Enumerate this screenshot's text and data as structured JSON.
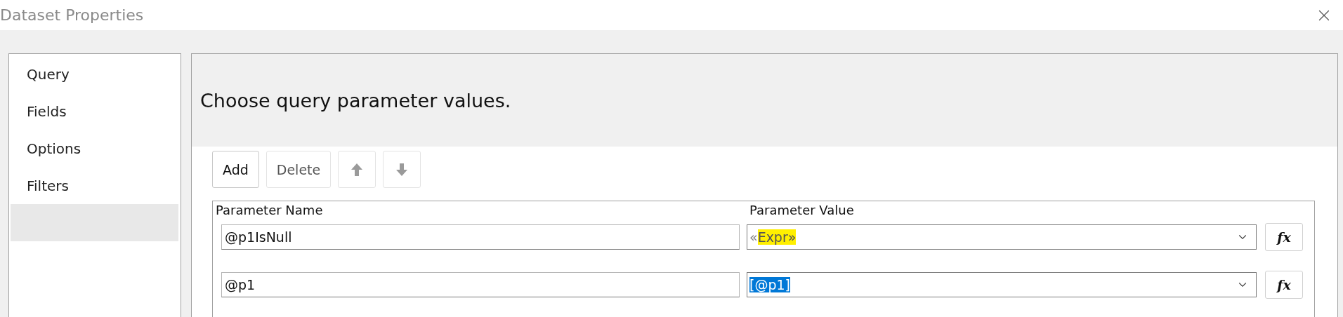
{
  "window": {
    "title": "Dataset Properties"
  },
  "sidebar": {
    "items": [
      {
        "label": "Query",
        "selected": false
      },
      {
        "label": "Fields",
        "selected": false
      },
      {
        "label": "Options",
        "selected": false
      },
      {
        "label": "Filters",
        "selected": false
      },
      {
        "selected": true
      }
    ]
  },
  "header": {
    "text": "Choose query parameter values."
  },
  "toolbar": [
    {
      "kind": "text",
      "label": "Add",
      "disabled": false
    },
    {
      "kind": "text",
      "label": "Delete",
      "disabled": true
    },
    {
      "kind": "up",
      "disabled": true
    },
    {
      "kind": "down",
      "disabled": true
    }
  ],
  "table": {
    "columns": [
      "Parameter Name",
      "Parameter Value"
    ],
    "rows": [
      {
        "name": "@p1IsNull",
        "value_parts": [
          {
            "text": "«",
            "highlighted": false,
            "selected": false
          },
          {
            "text": "Expr»",
            "highlighted": true,
            "selected": false
          }
        ],
        "function_button": "fx"
      },
      {
        "name": "@p1",
        "value_parts": [
          {
            "text": "[@p1]",
            "highlighted": false,
            "selected": true
          }
        ],
        "function_button": "fx"
      }
    ]
  }
}
